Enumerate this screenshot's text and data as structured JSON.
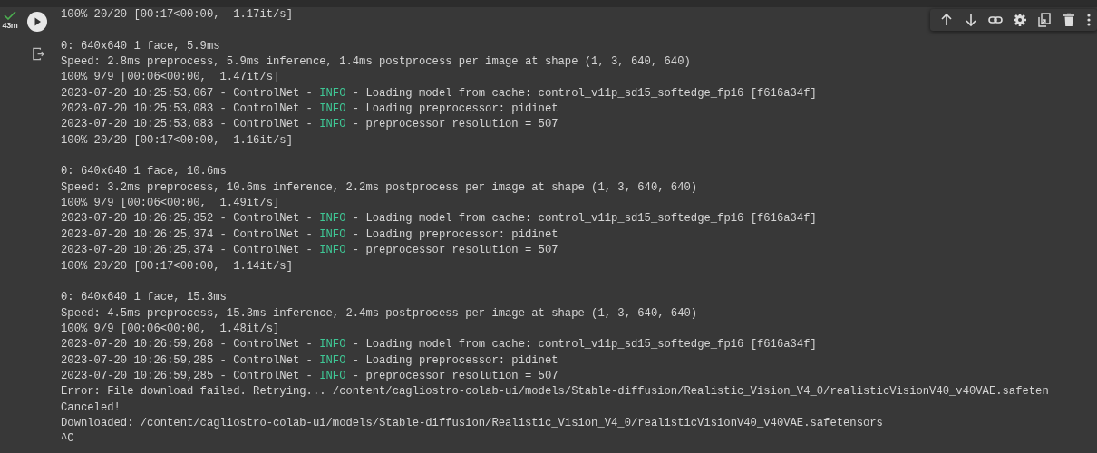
{
  "cell": {
    "succeeded": true,
    "elapsed": "43m"
  },
  "toolbar": [
    {
      "kind": "up"
    },
    {
      "kind": "down"
    },
    {
      "kind": "link"
    },
    {
      "kind": "settings"
    },
    {
      "kind": "mirror"
    },
    {
      "kind": "delete"
    },
    {
      "kind": "more"
    }
  ],
  "output": [
    {
      "kind": "plain",
      "text": "100% 20/20 [00:17<00:00,  1.17it/s]"
    },
    {
      "kind": "blank"
    },
    {
      "kind": "plain",
      "text": "0: 640x640 1 face, 5.9ms"
    },
    {
      "kind": "plain",
      "text": "Speed: 2.8ms preprocess, 5.9ms inference, 1.4ms postprocess per image at shape (1, 3, 640, 640)"
    },
    {
      "kind": "plain",
      "text": "100% 9/9 [00:06<00:00,  1.47it/s]"
    },
    {
      "kind": "log",
      "prefix": "2023-07-20 10:25:53,067 - ControlNet - ",
      "level": "INFO",
      "message": " - Loading model from cache: control_v11p_sd15_softedge_fp16 [f616a34f]"
    },
    {
      "kind": "log",
      "prefix": "2023-07-20 10:25:53,083 - ControlNet - ",
      "level": "INFO",
      "message": " - Loading preprocessor: pidinet"
    },
    {
      "kind": "log",
      "prefix": "2023-07-20 10:25:53,083 - ControlNet - ",
      "level": "INFO",
      "message": " - preprocessor resolution = 507"
    },
    {
      "kind": "plain",
      "text": "100% 20/20 [00:17<00:00,  1.16it/s]"
    },
    {
      "kind": "blank"
    },
    {
      "kind": "plain",
      "text": "0: 640x640 1 face, 10.6ms"
    },
    {
      "kind": "plain",
      "text": "Speed: 3.2ms preprocess, 10.6ms inference, 2.2ms postprocess per image at shape (1, 3, 640, 640)"
    },
    {
      "kind": "plain",
      "text": "100% 9/9 [00:06<00:00,  1.49it/s]"
    },
    {
      "kind": "log",
      "prefix": "2023-07-20 10:26:25,352 - ControlNet - ",
      "level": "INFO",
      "message": " - Loading model from cache: control_v11p_sd15_softedge_fp16 [f616a34f]"
    },
    {
      "kind": "log",
      "prefix": "2023-07-20 10:26:25,374 - ControlNet - ",
      "level": "INFO",
      "message": " - Loading preprocessor: pidinet"
    },
    {
      "kind": "log",
      "prefix": "2023-07-20 10:26:25,374 - ControlNet - ",
      "level": "INFO",
      "message": " - preprocessor resolution = 507"
    },
    {
      "kind": "plain",
      "text": "100% 20/20 [00:17<00:00,  1.14it/s]"
    },
    {
      "kind": "blank"
    },
    {
      "kind": "plain",
      "text": "0: 640x640 1 face, 15.3ms"
    },
    {
      "kind": "plain",
      "text": "Speed: 4.5ms preprocess, 15.3ms inference, 2.4ms postprocess per image at shape (1, 3, 640, 640)"
    },
    {
      "kind": "plain",
      "text": "100% 9/9 [00:06<00:00,  1.48it/s]"
    },
    {
      "kind": "log",
      "prefix": "2023-07-20 10:26:59,268 - ControlNet - ",
      "level": "INFO",
      "message": " - Loading model from cache: control_v11p_sd15_softedge_fp16 [f616a34f]"
    },
    {
      "kind": "log",
      "prefix": "2023-07-20 10:26:59,285 - ControlNet - ",
      "level": "INFO",
      "message": " - Loading preprocessor: pidinet"
    },
    {
      "kind": "log",
      "prefix": "2023-07-20 10:26:59,285 - ControlNet - ",
      "level": "INFO",
      "message": " - preprocessor resolution = 507"
    },
    {
      "kind": "plain",
      "text": "Error: File download failed. Retrying... /content/cagliostro-colab-ui/models/Stable-diffusion/Realistic_Vision_V4_0/realisticVisionV40_v40VAE.safeten"
    },
    {
      "kind": "plain",
      "text": "Canceled!"
    },
    {
      "kind": "plain",
      "text": "Downloaded: /content/cagliostro-colab-ui/models/Stable-diffusion/Realistic_Vision_V4_0/realisticVisionV40_v40VAE.safetensors"
    },
    {
      "kind": "plain",
      "text": "^C"
    }
  ]
}
